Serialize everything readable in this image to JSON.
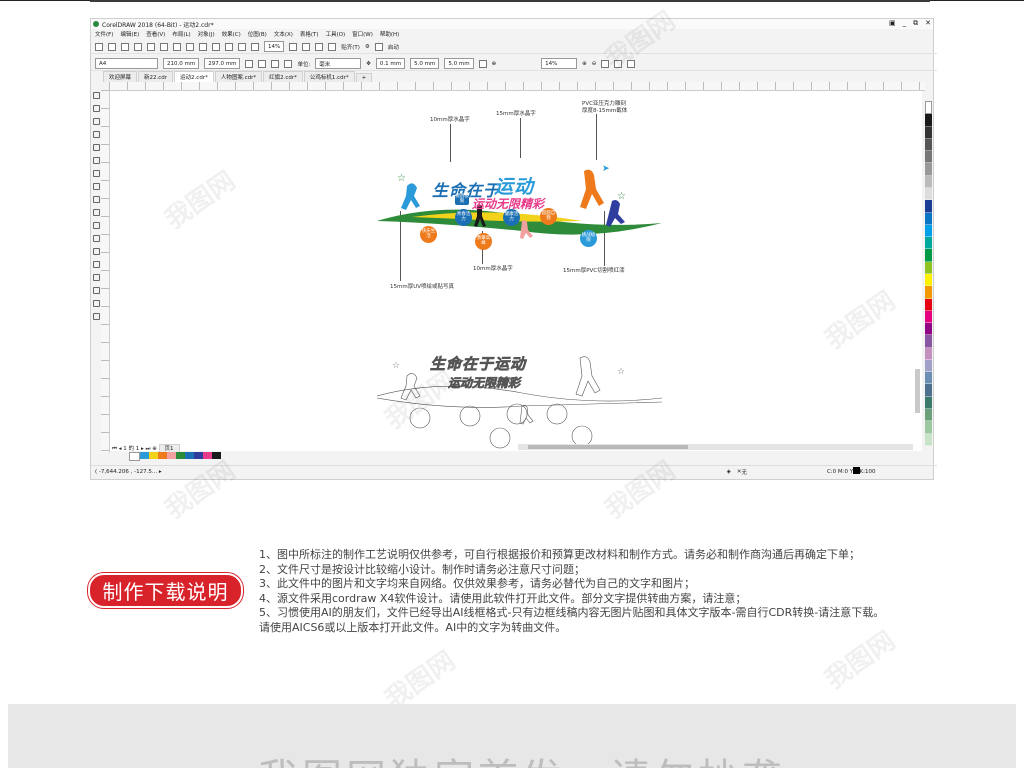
{
  "window": {
    "title": "CorelDRAW 2018 (64-Bit) - 运动2.cdr*",
    "controls": [
      "▣",
      "_",
      "⧉",
      "✕"
    ]
  },
  "menu": [
    "文件(F)",
    "编辑(E)",
    "查看(V)",
    "布局(L)",
    "对象(J)",
    "效果(C)",
    "位图(B)",
    "文本(X)",
    "表格(T)",
    "工具(O)",
    "窗口(W)",
    "帮助(H)"
  ],
  "toolbar1": {
    "zoom": "14%",
    "snap": "贴齐(T)",
    "launch": "启动"
  },
  "toolbar2": {
    "paper": "A4",
    "width": "210.0 mm",
    "height": "297.0 mm",
    "units_label": "单位:",
    "units": "毫米",
    "nudge": "0.1 mm",
    "dup_x": "5.0 mm",
    "dup_y": "5.0 mm",
    "zoom": "14%"
  },
  "tabs": [
    "欢迎屏幕",
    "新22.cdr",
    "运动2.cdr*",
    "人物图案.cdr*",
    "红旗2.cdr*",
    "公鸡标机1.cdr*"
  ],
  "artwork": {
    "labels": {
      "l1": "10mm厚水晶字",
      "l2": "15mm厚水晶字",
      "l3a": "PVC亚压克力雕刻",
      "l3b": "厚度8-15mm截体",
      "l4": "15mm厚UV喷绘或贴写真",
      "l5": "10mm厚水晶字",
      "l6": "15mm厚PVC切割喷红漆"
    },
    "title_a": "生命在于",
    "title_b": "运动",
    "subtitle": "运动无限精彩",
    "badge": "挑战极限",
    "circles": [
      "快乐生活",
      "青春活力",
      "勇攀高峰",
      "健康活力",
      "超越自我",
      "挑战极限",
      "运动健身"
    ],
    "outline_title": "生命在于运动",
    "outline_subtitle": "运动无限精彩"
  },
  "pagebar": "1 的 1",
  "page_tab": "页1",
  "status": {
    "coords": "( -7,644.206 , -127.5... ▸",
    "fill_none": "无",
    "color": "C:0 M:0 Y:0 K:100"
  },
  "badge": "制作下载说明",
  "notes": [
    "1、图中所标注的制作工艺说明仅供参考，可自行根据报价和预算更改材料和制作方式。请务必和制作商沟通后再确定下单；",
    "2、文件尺寸是按设计比较缩小设计。制作时请务必注意尺寸问题；",
    "3、此文件中的图片和文字均来自网络。仅供效果参考，请务必替代为自己的文字和图片；",
    "4、源文件采用cordraw X4软件设计。请使用此软件打开此文件。部分文字提供转曲方案，请注意；",
    "5、习惯使用AI的朋友们，文件已经导出AI线框格式-只有边框线稿内容无图片贴图和具体文字版本-需自行CDR转换-请注意下载。",
    "请使用AICS6或以上版本打开此文件。AI中的文字为转曲文件。"
  ],
  "watermark": "我图网",
  "footer": "我图网独家首发，请勿抄袭",
  "colors": {
    "accent_red": "#d9232b",
    "title_blue": "#1b6fb3",
    "green": "#2e8b3a",
    "yellow": "#f2d21b",
    "orange": "#ee7a1c"
  }
}
